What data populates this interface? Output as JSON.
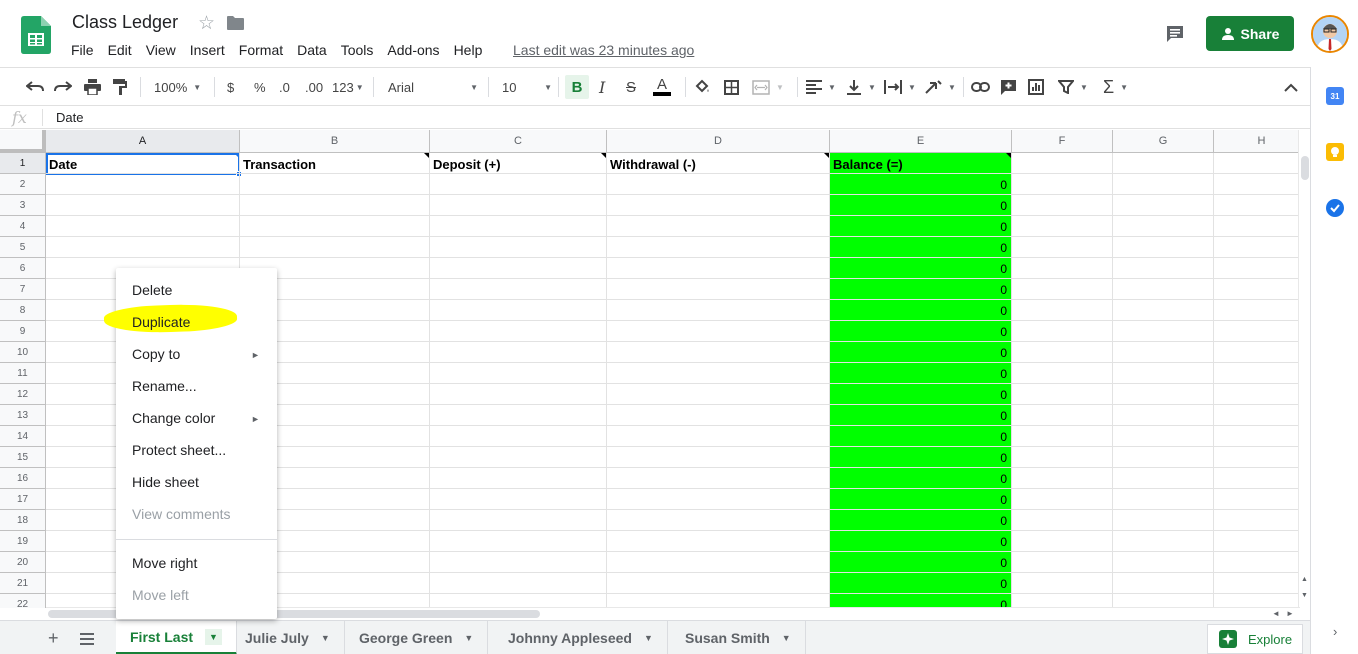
{
  "header": {
    "title": "Class Ledger",
    "menu": [
      "File",
      "Edit",
      "View",
      "Insert",
      "Format",
      "Data",
      "Tools",
      "Add-ons",
      "Help"
    ],
    "last_edit": "Last edit was 23 minutes ago",
    "share_label": "Share"
  },
  "toolbar": {
    "zoom": "100%",
    "currency": "$",
    "percent": "%",
    "dec_decrease": ".0",
    "dec_increase": ".00",
    "more_formats": "123",
    "font": "Arial",
    "font_size": "10",
    "bold": "B",
    "italic": "I",
    "strike": "S",
    "text_color": "A"
  },
  "formula_bar": {
    "fx": "fx",
    "value": "Date"
  },
  "grid": {
    "columns": [
      "A",
      "B",
      "C",
      "D",
      "E",
      "F",
      "G",
      "H"
    ],
    "rows": [
      "1",
      "2",
      "3",
      "4",
      "5",
      "6",
      "7",
      "8",
      "9",
      "10",
      "11",
      "12",
      "13",
      "14",
      "15",
      "16",
      "17",
      "18",
      "19",
      "20",
      "21",
      "22"
    ],
    "header_row": [
      "Date",
      "Transaction",
      "Deposit (+)",
      "Withdrawal (-)",
      "Balance (=)"
    ],
    "balance_values": [
      "0",
      "0",
      "0",
      "0",
      "0",
      "0",
      "0",
      "0",
      "0",
      "0",
      "0",
      "0",
      "0",
      "0",
      "0",
      "0",
      "0",
      "0",
      "0",
      "0",
      "0"
    ],
    "balance_color": "#00ff00"
  },
  "context_menu": {
    "items": [
      {
        "label": "Delete",
        "disabled": false,
        "submenu": false
      },
      {
        "label": "Duplicate",
        "disabled": false,
        "submenu": false,
        "highlighted": true
      },
      {
        "label": "Copy to",
        "disabled": false,
        "submenu": true
      },
      {
        "label": "Rename...",
        "disabled": false,
        "submenu": false
      },
      {
        "label": "Change color",
        "disabled": false,
        "submenu": true
      },
      {
        "label": "Protect sheet...",
        "disabled": false,
        "submenu": false
      },
      {
        "label": "Hide sheet",
        "disabled": false,
        "submenu": false
      },
      {
        "label": "View comments",
        "disabled": true,
        "submenu": false
      },
      {
        "label": "Move right",
        "disabled": false,
        "submenu": false
      },
      {
        "label": "Move left",
        "disabled": true,
        "submenu": false
      }
    ],
    "highlight_color": "#ffff00"
  },
  "sheets": {
    "tabs": [
      "First Last",
      "Julie July",
      "George Green",
      "Johnny Appleseed",
      "Susan Smith"
    ],
    "active": "First Last"
  },
  "explore_label": "Explore",
  "colors": {
    "brand_green": "#188038",
    "selection_blue": "#1a73e8"
  }
}
